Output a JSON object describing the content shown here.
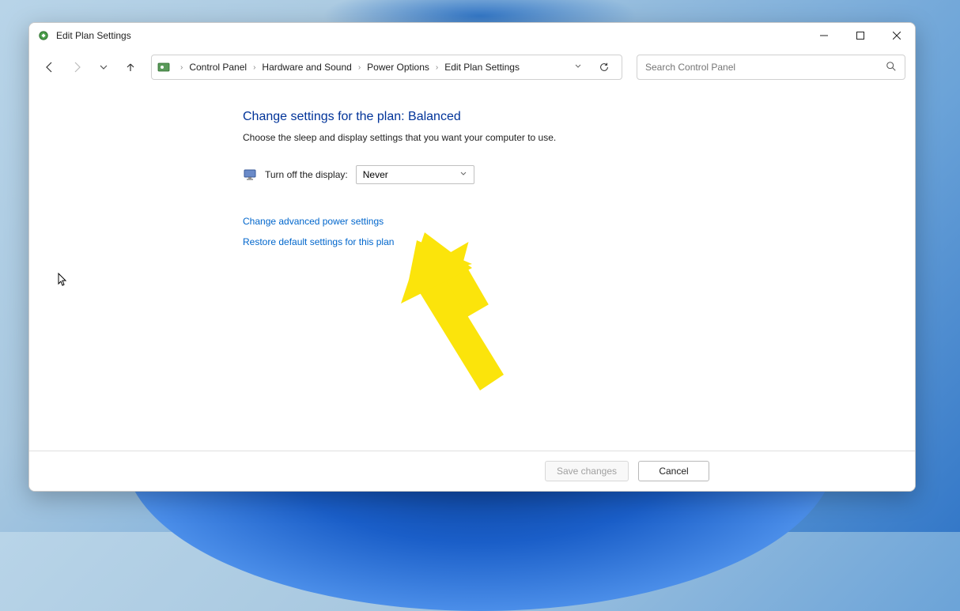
{
  "window": {
    "title": "Edit Plan Settings"
  },
  "breadcrumbs": {
    "items": [
      "Control Panel",
      "Hardware and Sound",
      "Power Options",
      "Edit Plan Settings"
    ]
  },
  "search": {
    "placeholder": "Search Control Panel"
  },
  "main": {
    "heading": "Change settings for the plan: Balanced",
    "subheading": "Choose the sleep and display settings that you want your computer to use.",
    "display_off": {
      "label": "Turn off the display:",
      "value": "Never"
    },
    "links": {
      "advanced": "Change advanced power settings",
      "restore": "Restore default settings for this plan"
    }
  },
  "buttons": {
    "save": "Save changes",
    "cancel": "Cancel"
  }
}
